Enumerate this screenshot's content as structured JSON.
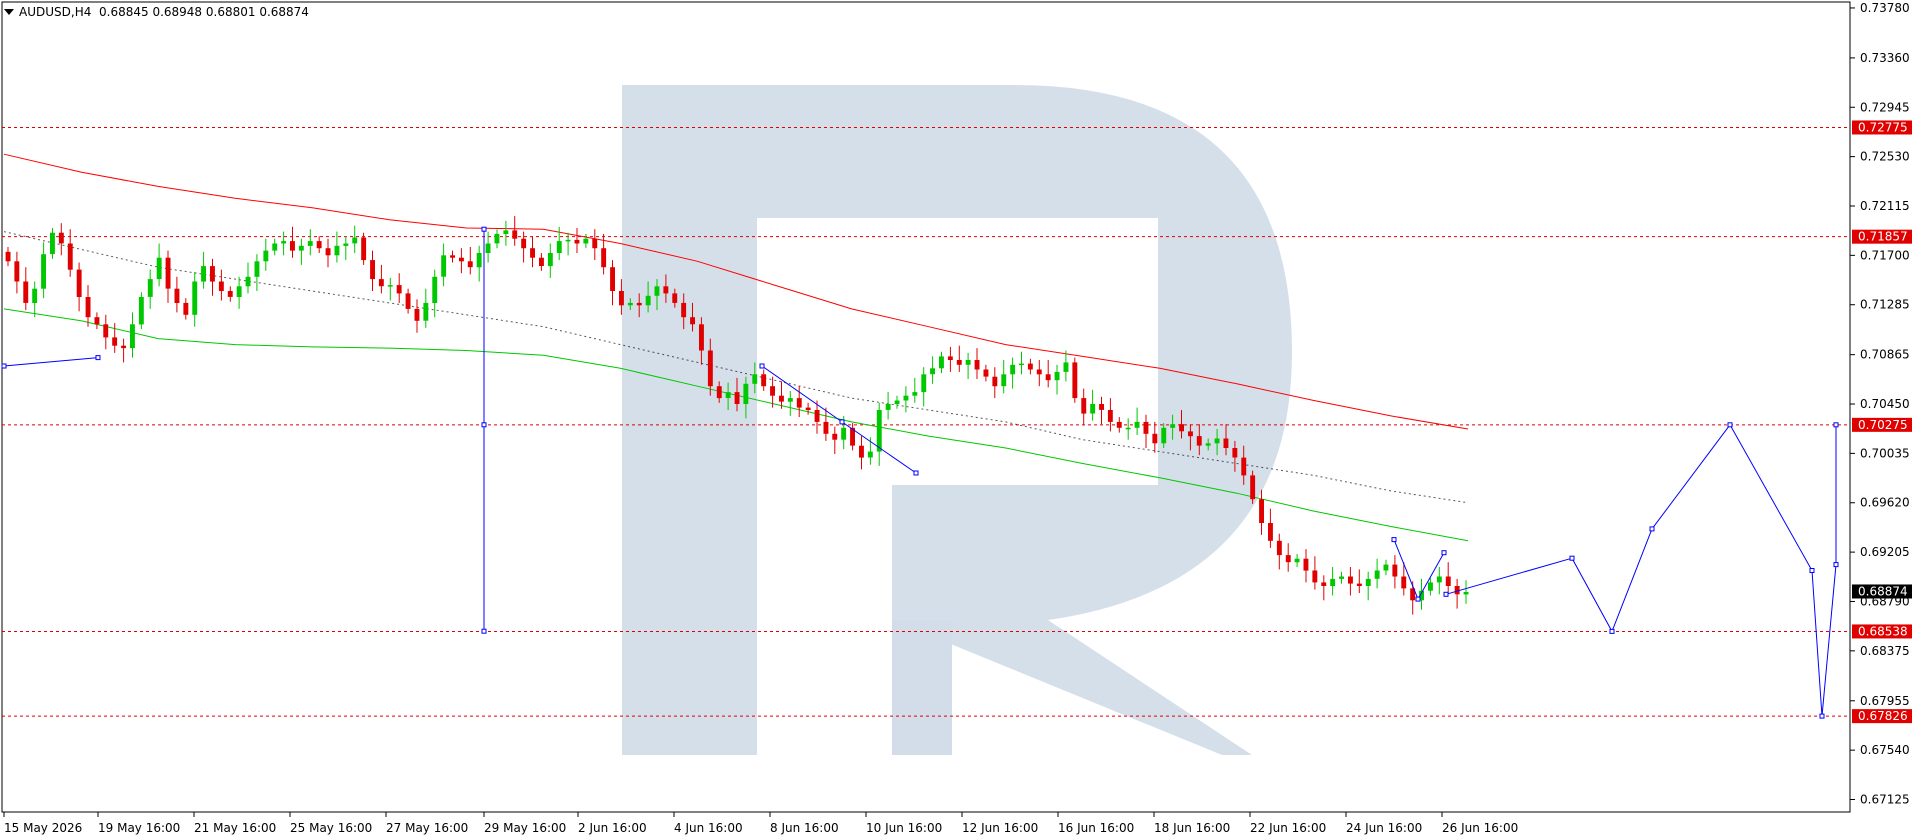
{
  "header": {
    "symbol": "AUDUSD,H4",
    "ohlc": "0.68845 0.68948 0.68801 0.68874"
  },
  "chart_data": {
    "type": "candlestick",
    "symbol": "AUDUSD",
    "timeframe": "H4",
    "ylim": [
      0.6702,
      0.7383
    ],
    "price_ticks": [
      "0.73780",
      "0.73360",
      "0.72945",
      "0.72530",
      "0.72115",
      "0.71700",
      "0.71285",
      "0.70865",
      "0.70450",
      "0.70035",
      "0.69620",
      "0.69205",
      "0.68790",
      "0.68375",
      "0.67955",
      "0.67540",
      "0.67125"
    ],
    "time_ticks": [
      "15 May 2026",
      "19 May 16:00",
      "21 May 16:00",
      "25 May 16:00",
      "27 May 16:00",
      "29 May 16:00",
      "2 Jun 16:00",
      "4 Jun 16:00",
      "8 Jun 16:00",
      "10 Jun 16:00",
      "12 Jun 16:00",
      "16 Jun 16:00",
      "18 Jun 16:00",
      "22 Jun 16:00",
      "24 Jun 16:00",
      "26 Jun 16:00"
    ],
    "levels": [
      {
        "label": "0.72775",
        "value": 0.72775
      },
      {
        "label": "0.71857",
        "value": 0.71857
      },
      {
        "label": "0.70275",
        "value": 0.70275
      },
      {
        "label": "0.68538",
        "value": 0.68538
      },
      {
        "label": "0.67826",
        "value": 0.67826
      }
    ],
    "current_price": {
      "label": "0.68874",
      "value": 0.68874
    },
    "closes": [
      0.7165,
      0.7148,
      0.713,
      0.7142,
      0.7171,
      0.7189,
      0.718,
      0.7158,
      0.7135,
      0.7118,
      0.7112,
      0.7101,
      0.7094,
      0.7092,
      0.7112,
      0.7135,
      0.715,
      0.7168,
      0.7142,
      0.713,
      0.712,
      0.7148,
      0.7161,
      0.7148,
      0.714,
      0.7135,
      0.7144,
      0.7152,
      0.7165,
      0.7174,
      0.718,
      0.7182,
      0.7174,
      0.7178,
      0.7182,
      0.7176,
      0.717,
      0.7178,
      0.718,
      0.7185,
      0.7166,
      0.715,
      0.7144,
      0.7145,
      0.7138,
      0.7125,
      0.7115,
      0.713,
      0.7152,
      0.717,
      0.7168,
      0.7165,
      0.716,
      0.7172,
      0.718,
      0.7188,
      0.7191,
      0.7184,
      0.7176,
      0.7168,
      0.7161,
      0.7172,
      0.7182,
      0.7183,
      0.718,
      0.7184,
      0.7176,
      0.716,
      0.714,
      0.7128,
      0.713,
      0.7128,
      0.7136,
      0.7144,
      0.7138,
      0.713,
      0.7118,
      0.7112,
      0.709,
      0.706,
      0.705,
      0.7055,
      0.7045,
      0.7062,
      0.707,
      0.706,
      0.7052,
      0.7047,
      0.705,
      0.7042,
      0.704,
      0.703,
      0.702,
      0.7015,
      0.7025,
      0.701,
      0.7,
      0.7005,
      0.704,
      0.7045,
      0.7048,
      0.7052,
      0.7055,
      0.707,
      0.7075,
      0.7085,
      0.7082,
      0.7078,
      0.7082,
      0.7074,
      0.7068,
      0.706,
      0.707,
      0.7078,
      0.7079,
      0.7074,
      0.707,
      0.7065,
      0.7072,
      0.708,
      0.705,
      0.7037,
      0.7045,
      0.704,
      0.703,
      0.7025,
      0.7025,
      0.703,
      0.702,
      0.7012,
      0.7025,
      0.7028,
      0.7022,
      0.7018,
      0.701,
      0.7012,
      0.7016,
      0.7008,
      0.7,
      0.6985,
      0.6965,
      0.6945,
      0.693,
      0.6918,
      0.6912,
      0.6915,
      0.6905,
      0.6895,
      0.6892,
      0.6898,
      0.69,
      0.6894,
      0.6892,
      0.6898,
      0.6905,
      0.691,
      0.69,
      0.689,
      0.688,
      0.6888,
      0.6895,
      0.69,
      0.6892,
      0.6885,
      0.6887
    ],
    "moving_averages": [
      {
        "color": "#ff0000",
        "values": [
          0.7255,
          0.724,
          0.7228,
          0.7218,
          0.721,
          0.72,
          0.7193,
          0.7192,
          0.718,
          0.7165,
          0.7145,
          0.7125,
          0.711,
          0.7095,
          0.7085,
          0.7075,
          0.7062,
          0.7048,
          0.7035,
          0.7024
        ]
      },
      {
        "color": "#000000",
        "values": [
          0.719,
          0.7175,
          0.716,
          0.715,
          0.714,
          0.713,
          0.712,
          0.711,
          0.7095,
          0.708,
          0.7065,
          0.705,
          0.704,
          0.703,
          0.7015,
          0.7005,
          0.6995,
          0.6985,
          0.6972,
          0.6962
        ]
      },
      {
        "color": "#00c800",
        "values": [
          0.7125,
          0.7115,
          0.71,
          0.7095,
          0.7093,
          0.7092,
          0.709,
          0.7086,
          0.7075,
          0.706,
          0.7045,
          0.703,
          0.7018,
          0.7008,
          0.6995,
          0.6983,
          0.697,
          0.6955,
          0.6942,
          0.693
        ]
      }
    ],
    "forecast": [
      0.6885,
      0.69154,
      0.68538,
      0.694,
      0.70275,
      0.6905,
      0.67826,
      0.691,
      0.70275
    ],
    "colors": {
      "bull": "#00c800",
      "bear": "#e00000",
      "level": "#e00000",
      "forecast": "#0000ff",
      "watermark": "#d3dde9",
      "current": "#000000"
    }
  }
}
